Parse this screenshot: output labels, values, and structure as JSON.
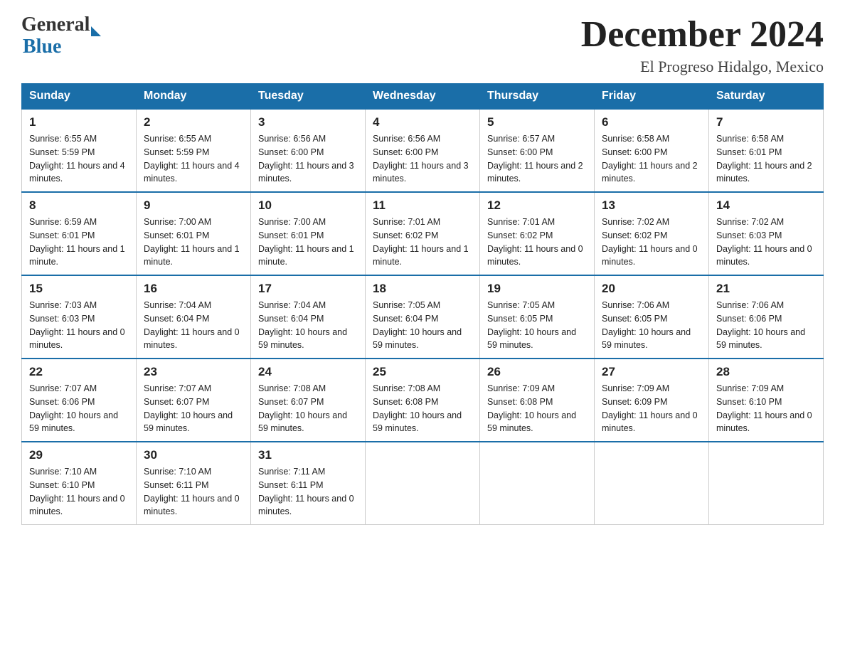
{
  "header": {
    "logo_general": "General",
    "logo_blue": "Blue",
    "title": "December 2024",
    "subtitle": "El Progreso Hidalgo, Mexico"
  },
  "days_of_week": [
    "Sunday",
    "Monday",
    "Tuesday",
    "Wednesday",
    "Thursday",
    "Friday",
    "Saturday"
  ],
  "weeks": [
    [
      {
        "day": "1",
        "sunrise": "6:55 AM",
        "sunset": "5:59 PM",
        "daylight": "11 hours and 4 minutes."
      },
      {
        "day": "2",
        "sunrise": "6:55 AM",
        "sunset": "5:59 PM",
        "daylight": "11 hours and 4 minutes."
      },
      {
        "day": "3",
        "sunrise": "6:56 AM",
        "sunset": "6:00 PM",
        "daylight": "11 hours and 3 minutes."
      },
      {
        "day": "4",
        "sunrise": "6:56 AM",
        "sunset": "6:00 PM",
        "daylight": "11 hours and 3 minutes."
      },
      {
        "day": "5",
        "sunrise": "6:57 AM",
        "sunset": "6:00 PM",
        "daylight": "11 hours and 2 minutes."
      },
      {
        "day": "6",
        "sunrise": "6:58 AM",
        "sunset": "6:00 PM",
        "daylight": "11 hours and 2 minutes."
      },
      {
        "day": "7",
        "sunrise": "6:58 AM",
        "sunset": "6:01 PM",
        "daylight": "11 hours and 2 minutes."
      }
    ],
    [
      {
        "day": "8",
        "sunrise": "6:59 AM",
        "sunset": "6:01 PM",
        "daylight": "11 hours and 1 minute."
      },
      {
        "day": "9",
        "sunrise": "7:00 AM",
        "sunset": "6:01 PM",
        "daylight": "11 hours and 1 minute."
      },
      {
        "day": "10",
        "sunrise": "7:00 AM",
        "sunset": "6:01 PM",
        "daylight": "11 hours and 1 minute."
      },
      {
        "day": "11",
        "sunrise": "7:01 AM",
        "sunset": "6:02 PM",
        "daylight": "11 hours and 1 minute."
      },
      {
        "day": "12",
        "sunrise": "7:01 AM",
        "sunset": "6:02 PM",
        "daylight": "11 hours and 0 minutes."
      },
      {
        "day": "13",
        "sunrise": "7:02 AM",
        "sunset": "6:02 PM",
        "daylight": "11 hours and 0 minutes."
      },
      {
        "day": "14",
        "sunrise": "7:02 AM",
        "sunset": "6:03 PM",
        "daylight": "11 hours and 0 minutes."
      }
    ],
    [
      {
        "day": "15",
        "sunrise": "7:03 AM",
        "sunset": "6:03 PM",
        "daylight": "11 hours and 0 minutes."
      },
      {
        "day": "16",
        "sunrise": "7:04 AM",
        "sunset": "6:04 PM",
        "daylight": "11 hours and 0 minutes."
      },
      {
        "day": "17",
        "sunrise": "7:04 AM",
        "sunset": "6:04 PM",
        "daylight": "10 hours and 59 minutes."
      },
      {
        "day": "18",
        "sunrise": "7:05 AM",
        "sunset": "6:04 PM",
        "daylight": "10 hours and 59 minutes."
      },
      {
        "day": "19",
        "sunrise": "7:05 AM",
        "sunset": "6:05 PM",
        "daylight": "10 hours and 59 minutes."
      },
      {
        "day": "20",
        "sunrise": "7:06 AM",
        "sunset": "6:05 PM",
        "daylight": "10 hours and 59 minutes."
      },
      {
        "day": "21",
        "sunrise": "7:06 AM",
        "sunset": "6:06 PM",
        "daylight": "10 hours and 59 minutes."
      }
    ],
    [
      {
        "day": "22",
        "sunrise": "7:07 AM",
        "sunset": "6:06 PM",
        "daylight": "10 hours and 59 minutes."
      },
      {
        "day": "23",
        "sunrise": "7:07 AM",
        "sunset": "6:07 PM",
        "daylight": "10 hours and 59 minutes."
      },
      {
        "day": "24",
        "sunrise": "7:08 AM",
        "sunset": "6:07 PM",
        "daylight": "10 hours and 59 minutes."
      },
      {
        "day": "25",
        "sunrise": "7:08 AM",
        "sunset": "6:08 PM",
        "daylight": "10 hours and 59 minutes."
      },
      {
        "day": "26",
        "sunrise": "7:09 AM",
        "sunset": "6:08 PM",
        "daylight": "10 hours and 59 minutes."
      },
      {
        "day": "27",
        "sunrise": "7:09 AM",
        "sunset": "6:09 PM",
        "daylight": "11 hours and 0 minutes."
      },
      {
        "day": "28",
        "sunrise": "7:09 AM",
        "sunset": "6:10 PM",
        "daylight": "11 hours and 0 minutes."
      }
    ],
    [
      {
        "day": "29",
        "sunrise": "7:10 AM",
        "sunset": "6:10 PM",
        "daylight": "11 hours and 0 minutes."
      },
      {
        "day": "30",
        "sunrise": "7:10 AM",
        "sunset": "6:11 PM",
        "daylight": "11 hours and 0 minutes."
      },
      {
        "day": "31",
        "sunrise": "7:11 AM",
        "sunset": "6:11 PM",
        "daylight": "11 hours and 0 minutes."
      },
      null,
      null,
      null,
      null
    ]
  ],
  "labels": {
    "sunrise": "Sunrise:",
    "sunset": "Sunset:",
    "daylight": "Daylight:"
  }
}
